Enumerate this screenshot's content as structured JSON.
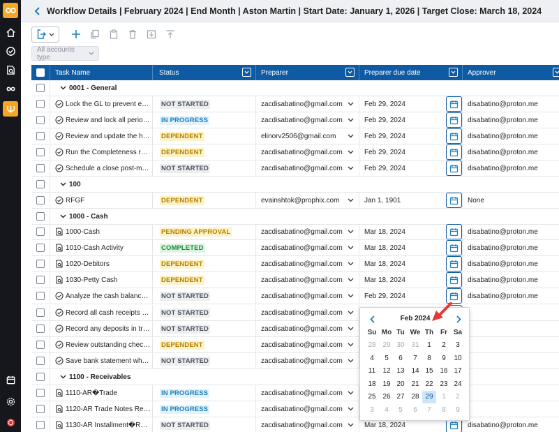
{
  "header": {
    "title": "Workflow Details | February 2024 | End Month | Aston Martin | Start Date: January 1, 2026 | Target Close: March 18, 2024"
  },
  "filters": {
    "accounts_type_placeholder": "All accounts type"
  },
  "columns": {
    "task_name": "Task Name",
    "status": "Status",
    "preparer": "Preparer",
    "preparer_due_date": "Preparer due date",
    "approver": "Approver"
  },
  "groups": {
    "g0001": "0001 - General",
    "g100": "100",
    "g1000": "1000 - Cash",
    "g1100": "1100 - Receivables"
  },
  "rows": [
    {
      "name": "Lock the GL to prevent entrie...",
      "status": "NOT STARTED",
      "preparer": "zacdisabatino@gmail.com",
      "due": "Feb 29, 2024",
      "approver": "disabatino@proton.me"
    },
    {
      "name": "Review and lock all periods t...",
      "status": "IN PROGRESS",
      "preparer": "zacdisabatino@gmail.com",
      "due": "Feb 29, 2024",
      "approver": "disabatino@proton.me"
    },
    {
      "name": "Review and update the holida...",
      "status": "DEPENDENT",
      "preparer": "elinorv2506@gmail.com",
      "due": "Feb 29, 2024",
      "approver": "disabatino@proton.me"
    },
    {
      "name": "Run the Completeness repor...",
      "status": "DEPENDENT",
      "preparer": "zacdisabatino@gmail.com",
      "due": "Feb 29, 2024",
      "approver": "disabatino@proton.me"
    },
    {
      "name": "Schedule a close post-morte...",
      "status": "NOT STARTED",
      "preparer": "zacdisabatino@gmail.com",
      "due": "Feb 29, 2024",
      "approver": "disabatino@proton.me"
    },
    {
      "name": "RFGF",
      "status": "DEPENDENT",
      "preparer": "evainshtok@prophix.com",
      "due": "Jan 1, 1901",
      "approver": "None"
    },
    {
      "name": "1000-Cash",
      "status": "PENDING APPROVAL",
      "preparer": "zacdisabatino@gmail.com",
      "due": "Mar 18, 2024",
      "approver": "disabatino@proton.me"
    },
    {
      "name": "1010-Cash Activity",
      "status": "COMPLETED",
      "preparer": "zacdisabatino@gmail.com",
      "due": "Mar 18, 2024",
      "approver": "disabatino@proton.me"
    },
    {
      "name": "1020-Debitors",
      "status": "DEPENDENT",
      "preparer": "zacdisabatino@gmail.com",
      "due": "Mar 18, 2024",
      "approver": "disabatino@proton.me"
    },
    {
      "name": "1030-Petty Cash",
      "status": "DEPENDENT",
      "preparer": "zacdisabatino@gmail.com",
      "due": "Mar 18, 2024",
      "approver": "disabatino@proton.me"
    },
    {
      "name": "Analyze the cash balances at ...",
      "status": "NOT STARTED",
      "preparer": "zacdisabatino@gmail.com",
      "due": "Feb 29, 2024",
      "approver": "disabatino@proton.me"
    },
    {
      "name": "Record all cash receipts and d...",
      "status": "NOT STARTED",
      "preparer": "zacdisabatino@gmail.com",
      "due": "",
      "approver": ""
    },
    {
      "name": "Record any deposits in transi...",
      "status": "NOT STARTED",
      "preparer": "zacdisabatino@gmail.com",
      "due": "",
      "approver": ""
    },
    {
      "name": "Review outstanding check lis...",
      "status": "DEPENDENT",
      "preparer": "zacdisabatino@gmail.com",
      "due": "",
      "approver": ""
    },
    {
      "name": "Save bank statement when th...",
      "status": "NOT STARTED",
      "preparer": "zacdisabatino@gmail.com",
      "due": "",
      "approver": ""
    },
    {
      "name": "1110-AR�Trade",
      "status": "IN PROGRESS",
      "preparer": "zacdisabatino@gmail.com",
      "due": "",
      "approver": ""
    },
    {
      "name": "1120-AR Trade Notes Receiv...",
      "status": "IN PROGRESS",
      "preparer": "zacdisabatino@gmail.com",
      "due": "",
      "approver": ""
    },
    {
      "name": "1130-AR Installment�Recei...",
      "status": "NOT STARTED",
      "preparer": "zacdisabatino@gmail.com",
      "due": "Mar 18, 2024",
      "approver": "disabatino@proton.me"
    }
  ],
  "calendar": {
    "month_label": "Feb 2024",
    "weekdays": [
      "Su",
      "Mo",
      "Tu",
      "We",
      "Th",
      "Fr",
      "Sa"
    ],
    "days": [
      [
        "28",
        "29",
        "30",
        "31",
        "1",
        "2",
        "3"
      ],
      [
        "4",
        "5",
        "6",
        "7",
        "8",
        "9",
        "10"
      ],
      [
        "11",
        "12",
        "13",
        "14",
        "15",
        "16",
        "17"
      ],
      [
        "18",
        "19",
        "20",
        "21",
        "22",
        "23",
        "24"
      ],
      [
        "25",
        "26",
        "27",
        "28",
        "29",
        "1",
        "2"
      ],
      [
        "3",
        "4",
        "5",
        "6",
        "7",
        "8",
        "9"
      ]
    ],
    "selected_day": "29"
  }
}
